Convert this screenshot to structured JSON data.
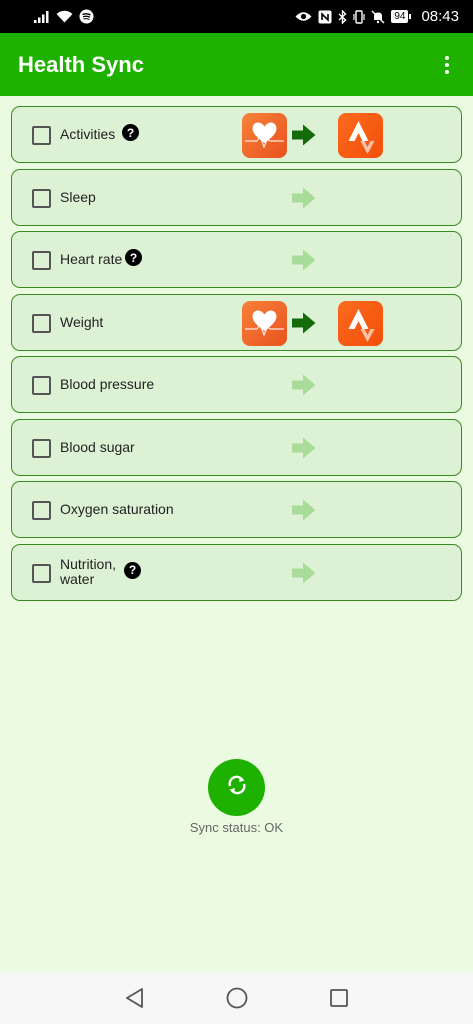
{
  "status_bar": {
    "battery": "94",
    "time": "08:43"
  },
  "app_bar": {
    "title": "Health Sync"
  },
  "rows": [
    {
      "label": "Activities",
      "help": true,
      "active": true
    },
    {
      "label": "Sleep",
      "help": false,
      "active": false
    },
    {
      "label": "Heart rate",
      "help": true,
      "active": false
    },
    {
      "label": "Weight",
      "help": false,
      "active": true
    },
    {
      "label": "Blood pressure",
      "help": false,
      "active": false
    },
    {
      "label": "Blood sugar",
      "help": false,
      "active": false
    },
    {
      "label": "Oxygen saturation",
      "help": false,
      "active": false
    },
    {
      "label": "Nutrition, water",
      "help": true,
      "active": false
    }
  ],
  "help_symbol": "?",
  "sync": {
    "status_text": "Sync status: OK"
  },
  "colors": {
    "primary": "#1fb100",
    "background": "#eafbe2",
    "row_background": "#ddf2d4",
    "row_border": "#3a8a23",
    "arrow_active": "#146b0b",
    "arrow_inactive": "#a9dc98",
    "health_icon": "#f26b2a",
    "strava_icon": "#fc5200"
  },
  "icons": {
    "source_app": "heart-pulse-icon",
    "target_app": "strava-icon",
    "direction": "arrow-right-icon",
    "sync": "refresh-icon"
  }
}
